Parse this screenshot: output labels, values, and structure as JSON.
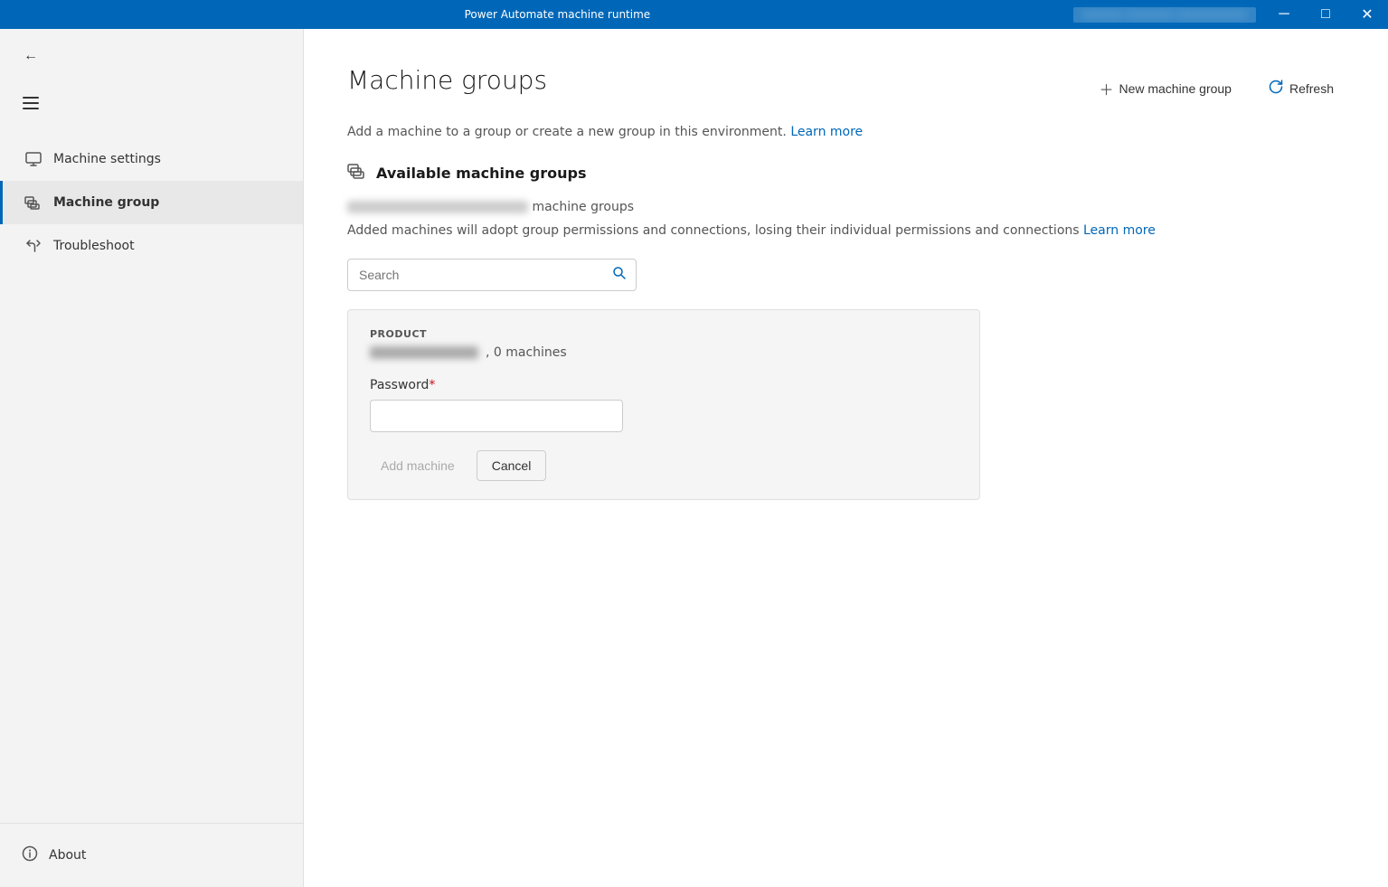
{
  "titlebar": {
    "title": "Power Automate machine runtime",
    "user_label": "••••••• •••••••• ••••••••••••",
    "min_label": "─",
    "max_label": "□",
    "close_label": "✕"
  },
  "sidebar": {
    "back_label": "←",
    "nav_items": [
      {
        "id": "machine-settings",
        "label": "Machine settings",
        "active": false
      },
      {
        "id": "machine-group",
        "label": "Machine group",
        "active": true
      },
      {
        "id": "troubleshoot",
        "label": "Troubleshoot",
        "active": false
      }
    ],
    "about_label": "About"
  },
  "page": {
    "title": "Machine groups",
    "subtitle_text": "Add a machine to a group or create a new group in this environment.",
    "subtitle_link_label": "Learn more",
    "new_machine_group_label": "New machine group",
    "refresh_label": "Refresh",
    "section_title": "Available machine groups",
    "env_blurred_text": "██████████████████████",
    "env_suffix": "machine groups",
    "info_text": "Added machines will adopt group permissions and connections, losing their individual permissions and connections",
    "info_link_label": "Learn more",
    "search_placeholder": "Search",
    "card": {
      "header_label": "PRODUCT",
      "group_name_blurred": "██████████",
      "machines_count": ", 0 machines",
      "password_label": "Password",
      "password_required": "*",
      "add_machine_label": "Add machine",
      "cancel_label": "Cancel"
    }
  }
}
